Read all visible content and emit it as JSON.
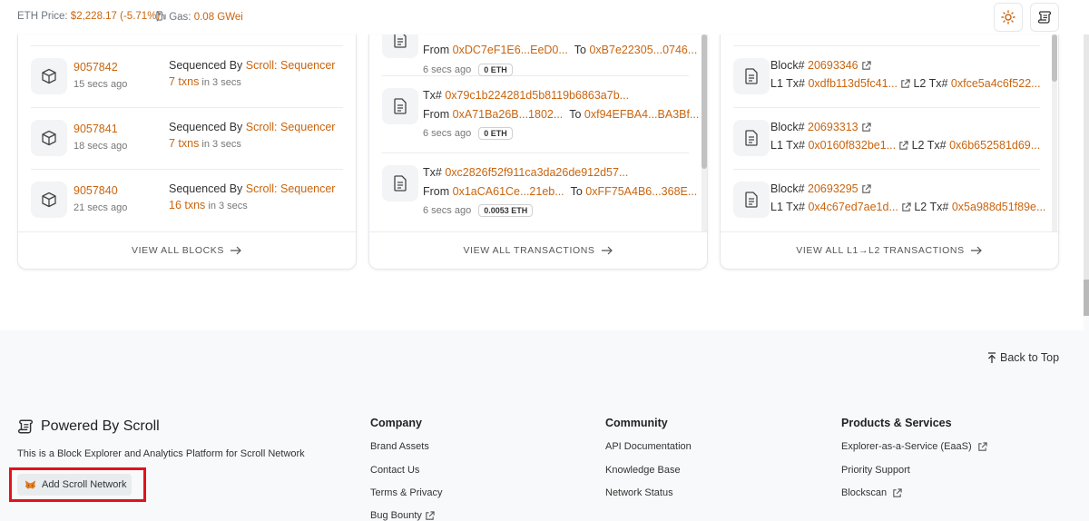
{
  "header": {
    "eth_label": "ETH Price:",
    "eth_price": "$2,228.17 (-5.71%)",
    "gas_label": "Gas:",
    "gas_value": "0.08 GWei",
    "theme_icon": "sun-icon",
    "menu_icon": "scroll-logo-icon"
  },
  "blocks": {
    "rows": [
      {
        "number": "9057842",
        "age": "15 secs ago",
        "seq_label": "Sequenced By",
        "sequencer": "Scroll: Sequencer",
        "txns": "7 txns",
        "time": "in 3 secs"
      },
      {
        "number": "9057841",
        "age": "18 secs ago",
        "seq_label": "Sequenced By",
        "sequencer": "Scroll: Sequencer",
        "txns": "7 txns",
        "time": "in 3 secs"
      },
      {
        "number": "9057840",
        "age": "21 secs ago",
        "seq_label": "Sequenced By",
        "sequencer": "Scroll: Sequencer",
        "txns": "16 txns",
        "time": "in 3 secs"
      }
    ],
    "footer": "VIEW ALL BLOCKS"
  },
  "transactions": {
    "partial": {
      "from": "0xDC7eF1E6...EeD0...",
      "to": "0xB7e22305...0746...",
      "age": "6 secs ago",
      "value": "0 ETH"
    },
    "rows": [
      {
        "hash": "0x79c1b224281d5b8119b6863a7b...",
        "from": "0xA71Ba26B...1802...",
        "to": "0xf94EFBA4...BA3Bf...",
        "age": "6 secs ago",
        "value": "0 ETH"
      },
      {
        "hash": "0xc2826f52f911ca3da26de912d57...",
        "from": "0x1aCA61Ce...21eb...",
        "to": "0xFF75A4B6...368E...",
        "age": "6 secs ago",
        "value": "0.0053 ETH"
      }
    ],
    "tx_label": "Tx#",
    "from_label": "From",
    "to_label": "To",
    "footer": "VIEW ALL TRANSACTIONS"
  },
  "l1l2": {
    "rows": [
      {
        "block": "20693346",
        "l1tx": "0xdfb113d5fc41...",
        "l2tx": "0xfce5a4c6f522..."
      },
      {
        "block": "20693313",
        "l1tx": "0x0160f832be1...",
        "l2tx": "0x6b652581d69..."
      },
      {
        "block": "20693295",
        "l1tx": "0x4c67ed7ae1d...",
        "l2tx": "0x5a988d51f89e..."
      }
    ],
    "block_label": "Block#",
    "l1_label": "L1 Tx#",
    "l2_label": "L2 Tx#",
    "footer": "VIEW ALL L1→L2 TRANSACTIONS"
  },
  "footer": {
    "back_to_top": "Back to Top",
    "powered_by": "Powered By Scroll",
    "tagline": "This is a Block Explorer and Analytics Platform for Scroll Network",
    "add_network": "Add Scroll Network",
    "company": {
      "title": "Company",
      "links": [
        "Brand Assets",
        "Contact Us",
        "Terms & Privacy",
        "Bug Bounty"
      ]
    },
    "community": {
      "title": "Community",
      "links": [
        "API Documentation",
        "Knowledge Base",
        "Network Status"
      ]
    },
    "products": {
      "title": "Products & Services",
      "links": [
        "Explorer-as-a-Service (EaaS)",
        "Priority Support",
        "Blockscan"
      ]
    }
  },
  "colors": {
    "accent": "#c9650f",
    "highlight_frame": "#e0141c"
  }
}
